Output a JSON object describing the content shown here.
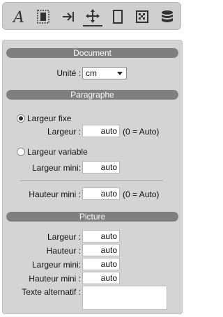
{
  "toolbar": {
    "tools": [
      {
        "icon": "text-font-icon"
      },
      {
        "icon": "frame-padding-icon"
      },
      {
        "icon": "indent-arrow-icon"
      },
      {
        "icon": "move-arrows-icon",
        "active": true
      },
      {
        "icon": "page-rectangle-icon"
      },
      {
        "icon": "pattern-fill-icon"
      },
      {
        "icon": "database-icon"
      }
    ]
  },
  "document": {
    "title": "Document",
    "unit_label": "Unité :",
    "unit_value": "cm"
  },
  "paragraph": {
    "title": "Paragraphe",
    "fixed_width_option": "Largeur fixe",
    "fixed_width_selected": true,
    "width_label": "Largeur :",
    "width_value": "auto",
    "width_hint": "(0 = Auto)",
    "variable_width_option": "Largeur variable",
    "variable_width_selected": false,
    "min_width_label": "Largeur mini:",
    "min_width_value": "auto",
    "min_height_label": "Hauteur mini :",
    "min_height_value": "auto",
    "min_height_hint": "(0 = Auto)"
  },
  "picture": {
    "title": "Picture",
    "width_label": "Largeur :",
    "width_value": "auto",
    "height_label": "Hauteur :",
    "height_value": "auto",
    "min_width_label": "Largeur mini:",
    "min_width_value": "auto",
    "min_height_label": "Hauteur mini :",
    "min_height_value": "auto",
    "alt_text_label": "Texte alternatif :",
    "alt_text_value": ""
  }
}
